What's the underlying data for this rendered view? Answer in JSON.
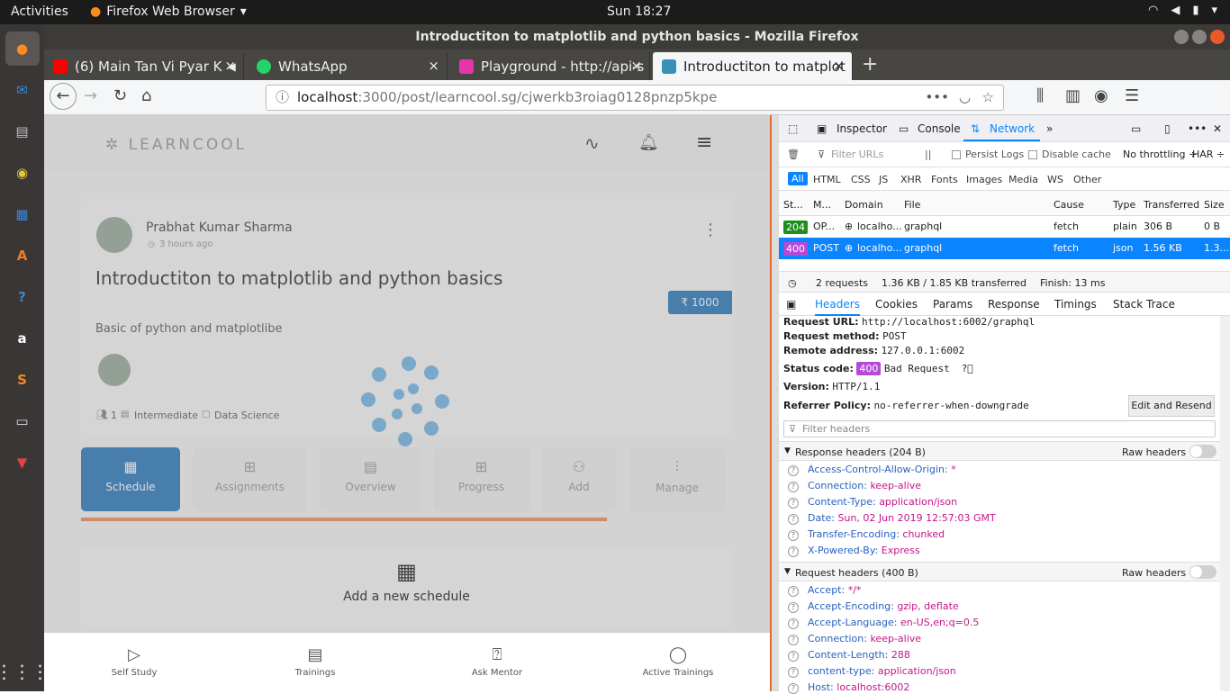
{
  "system": {
    "activities": "Activities",
    "app_name": "Firefox Web Browser",
    "clock": "Sun 18:27"
  },
  "window": {
    "title": "Introductiton to matplotlib and python basics - Mozilla Firefox"
  },
  "tabs": [
    {
      "label": "(6) Main Tan Vi Pyar K",
      "icon": "youtube-icon",
      "color": "#ff0000"
    },
    {
      "label": "WhatsApp",
      "icon": "whatsapp-icon",
      "color": "#25d366"
    },
    {
      "label": "Playground - http://api-s",
      "icon": "graphql-icon",
      "color": "#e535ab"
    },
    {
      "label": "Introductiton to matplot",
      "icon": "learncool-icon",
      "color": "#3a8fb7"
    }
  ],
  "urlbar": {
    "host": "localhost",
    "rest": ":3000/post/learncool.sg/cjwerkb3roiag0128pnzp5kpe"
  },
  "page": {
    "brand": "LEARNCOOL",
    "author": "Prabhat Kumar Sharma",
    "time_ago": "3 hours ago",
    "title": "Introductiton to matplotlib and python basics",
    "price": "₹ 1000",
    "description": "Basic of python and matplotlibe",
    "count": "1",
    "level": "Intermediate",
    "category": "Data Science",
    "tiles": [
      "Schedule",
      "Assignments",
      "Overview",
      "Progress",
      "Add",
      "Manage"
    ],
    "add_schedule": "Add a new schedule",
    "bottom_nav": [
      "Self Study",
      "Trainings",
      "Ask Mentor",
      "Active Trainings"
    ]
  },
  "devtools": {
    "tabs": [
      "Inspector",
      "Console",
      "Network"
    ],
    "filter_placeholder": "Filter URLs",
    "persist_logs": "Persist Logs",
    "disable_cache": "Disable cache",
    "throttling": "No throttling ÷",
    "har": "HAR ÷",
    "type_filters": [
      "All",
      "HTML",
      "CSS",
      "JS",
      "XHR",
      "Fonts",
      "Images",
      "Media",
      "WS",
      "Other"
    ],
    "columns": [
      "St...",
      "M...",
      "Domain",
      "File",
      "Cause",
      "Type",
      "Transferred",
      "Size"
    ],
    "requests": [
      {
        "status": "204",
        "method": "OP...",
        "domain": "localho...",
        "file": "graphql",
        "cause": "fetch",
        "type": "plain",
        "transferred": "306 B",
        "size": "0 B",
        "status_color": "#1d8f1d"
      },
      {
        "status": "400",
        "method": "POST",
        "domain": "localho...",
        "file": "graphql",
        "cause": "fetch",
        "type": "json",
        "transferred": "1.56 KB",
        "size": "1.3...",
        "status_color": "#b44ad6"
      }
    ],
    "summary": {
      "requests": "2 requests",
      "size": "1.36 KB / 1.85 KB transferred",
      "finish": "Finish: 13 ms"
    },
    "detail_tabs": [
      "Headers",
      "Cookies",
      "Params",
      "Response",
      "Timings",
      "Stack Trace"
    ],
    "request_url_label": "Request URL:",
    "request_url": "http://localhost:6002/graphql",
    "request_method_label": "Request method:",
    "request_method": "POST",
    "remote_address_label": "Remote address:",
    "remote_address": "127.0.0.1:6002",
    "status_code_label": "Status code:",
    "status_code": "400",
    "status_text": "Bad Request",
    "version_label": "Version:",
    "version": "HTTP/1.1",
    "referrer_label": "Referrer Policy:",
    "referrer": "no-referrer-when-downgrade",
    "edit_resend": "Edit and Resend",
    "filter_headers": "Filter headers",
    "response_headers_title": "Response headers (204 B)",
    "raw_headers": "Raw headers",
    "response_headers": [
      {
        "name": "Access-Control-Allow-Origin:",
        "value": "*"
      },
      {
        "name": "Connection:",
        "value": "keep-alive"
      },
      {
        "name": "Content-Type:",
        "value": "application/json"
      },
      {
        "name": "Date:",
        "value": "Sun, 02 Jun 2019 12:57:03 GMT"
      },
      {
        "name": "Transfer-Encoding:",
        "value": "chunked"
      },
      {
        "name": "X-Powered-By:",
        "value": "Express"
      }
    ],
    "request_headers_title": "Request headers (400 B)",
    "request_headers": [
      {
        "name": "Accept:",
        "value": "*/*"
      },
      {
        "name": "Accept-Encoding:",
        "value": "gzip, deflate"
      },
      {
        "name": "Accept-Language:",
        "value": "en-US,en;q=0.5"
      },
      {
        "name": "Connection:",
        "value": "keep-alive"
      },
      {
        "name": "Content-Length:",
        "value": "288"
      },
      {
        "name": "content-type:",
        "value": "application/json"
      },
      {
        "name": "Host:",
        "value": "localhost:6002"
      }
    ]
  }
}
